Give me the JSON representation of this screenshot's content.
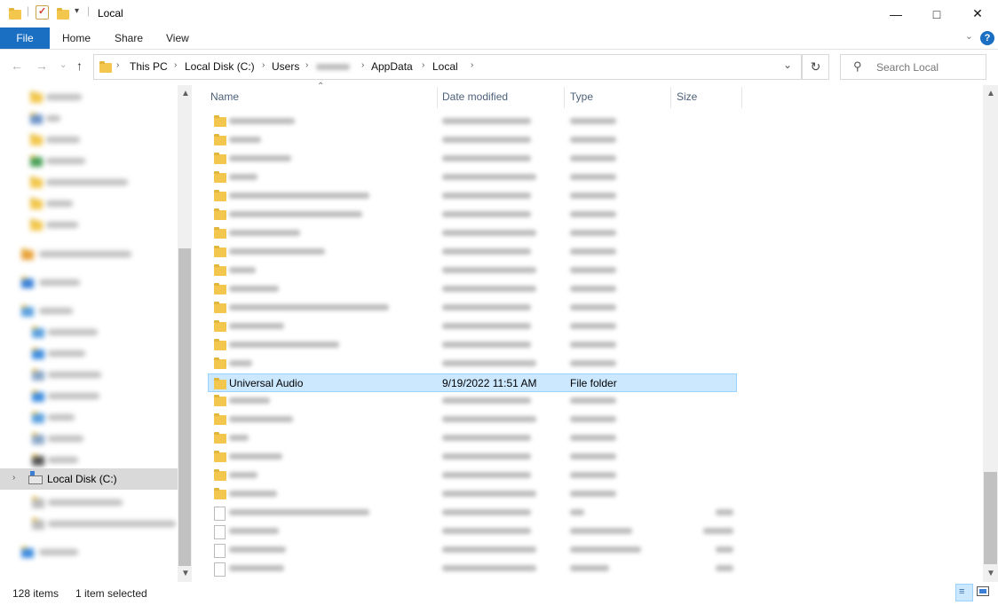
{
  "window": {
    "title": "Local"
  },
  "ribbon": {
    "file": "File",
    "home": "Home",
    "share": "Share",
    "view": "View"
  },
  "address": {
    "crumbs": [
      "This PC",
      "Local Disk (C:)",
      "Users",
      "",
      "AppData",
      "Local"
    ]
  },
  "search": {
    "placeholder": "Search Local"
  },
  "columns": {
    "name": "Name",
    "date": "Date modified",
    "type": "Type",
    "size": "Size"
  },
  "nav": {
    "local_disk": "Local Disk (C:)"
  },
  "selected_row": {
    "name": "Universal Audio",
    "date": "9/19/2022 11:51 AM",
    "type": "File folder"
  },
  "status": {
    "items": "128 items",
    "selected": "1 item selected"
  },
  "colors": {
    "accent": "#1a6fc2",
    "folder": "#f3c74d",
    "selection": "#cce8ff"
  }
}
